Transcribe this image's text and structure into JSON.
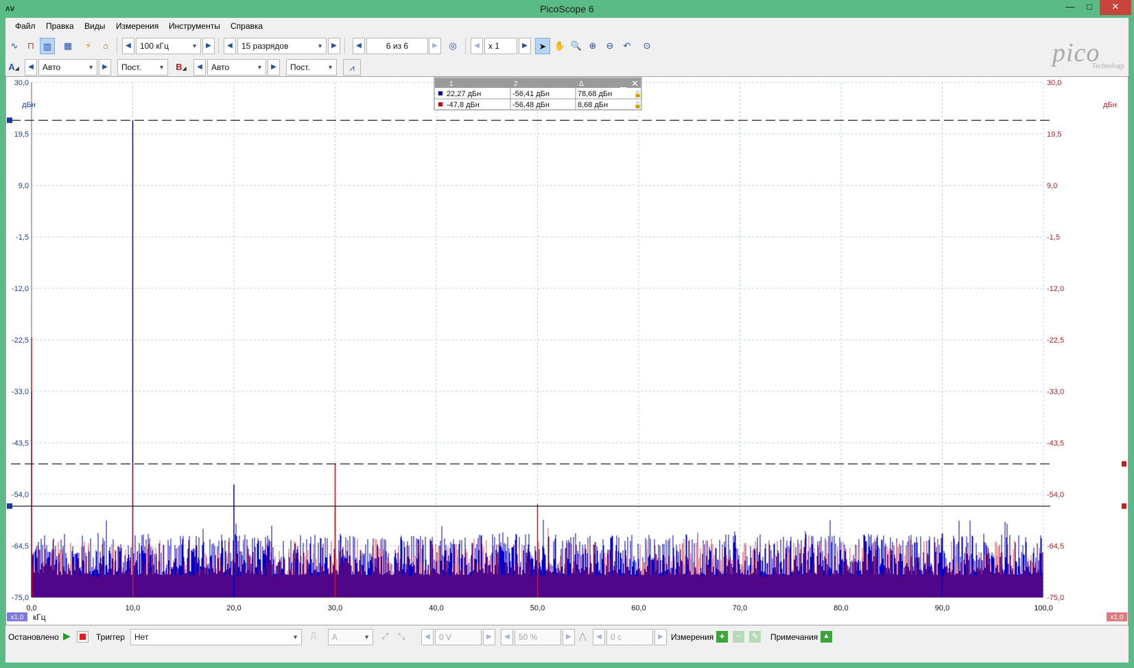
{
  "window": {
    "title": "PicoScope 6",
    "minimize": "—",
    "maximize": "□",
    "close": "✕"
  },
  "menu": [
    "Файл",
    "Правка",
    "Виды",
    "Измерения",
    "Инструменты",
    "Справка"
  ],
  "toolbar1": {
    "timebase": "100 кГц",
    "resolution": "15 разрядов",
    "capture": "6 из 6",
    "zoom": "x 1"
  },
  "toolbar2": {
    "channelA": {
      "label": "A",
      "range": "Авто",
      "coupling": "Пост."
    },
    "channelB": {
      "label": "B",
      "range": "Авто",
      "coupling": "Пост."
    }
  },
  "logo": {
    "word": "pico",
    "sub": "Technology"
  },
  "rulers": {
    "headers": [
      "1",
      "2",
      "Δ"
    ],
    "rows": [
      {
        "color": "#0000aa",
        "v1": "22,27 дБн",
        "v2": "-56,41 дБн",
        "delta": "78,68 дБн"
      },
      {
        "color": "#cc0000",
        "v1": "-47,8 дБн",
        "v2": "-56,48 дБн",
        "delta": "8,68 дБн"
      }
    ]
  },
  "chart_data": {
    "type": "line",
    "xunit": "кГц",
    "yunit_left": "дБн",
    "yunit_right": "дБн",
    "xlim": [
      0,
      100
    ],
    "ylim": [
      -75,
      30
    ],
    "y_ticks_labels": [
      "30,0",
      "19,5",
      "9,0",
      "-1,5",
      "-12,0",
      "-22,5",
      "-33,0",
      "-43,5",
      "-54,0",
      "-64,5",
      "-75,0"
    ],
    "x_ticks_labels": [
      "0,0",
      "10,0",
      "20,0",
      "30,0",
      "40,0",
      "50,0",
      "60,0",
      "70,0",
      "80,0",
      "90,0",
      "100,0"
    ],
    "series": [
      {
        "name": "A",
        "color": "#0000cc",
        "peaks": [
          {
            "x": 0.0,
            "y": -33
          },
          {
            "x": 10.0,
            "y": 22.27
          },
          {
            "x": 20.0,
            "y": -52
          },
          {
            "x": 30.0,
            "y": -56.4
          },
          {
            "x": 90.0,
            "y": -62
          }
        ],
        "noise_floor": [
          -75,
          -62
        ]
      },
      {
        "name": "B",
        "color": "#dd1111",
        "peaks": [
          {
            "x": 0.0,
            "y": -22
          },
          {
            "x": 10.0,
            "y": -48
          },
          {
            "x": 30.0,
            "y": -47.8
          },
          {
            "x": 50.0,
            "y": -56
          }
        ],
        "noise_floor": [
          -75,
          -63
        ]
      }
    ],
    "ruler_lines": [
      {
        "y": 22.27,
        "style": "dashed"
      },
      {
        "y": -47.8,
        "style": "dashed"
      },
      {
        "y": -56.41,
        "style": "solid"
      }
    ],
    "left_scale_label": "x1,0",
    "right_scale_label": "x1,0",
    "grid": true
  },
  "status": {
    "state": "Остановлено",
    "trigger_label": "Триггер",
    "trigger_mode": "Нет",
    "trigger_channel": "A",
    "threshold": "0 V",
    "pretrigger": "50 %",
    "delay": "0 с",
    "measurements": "Измерения",
    "notes": "Примечания"
  }
}
